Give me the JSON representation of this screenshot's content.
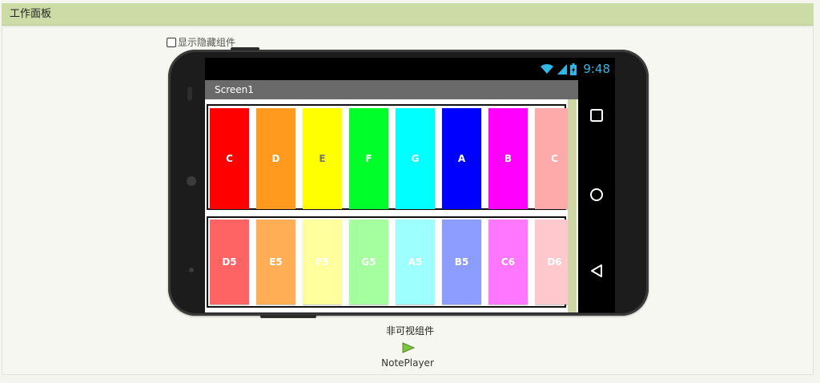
{
  "panel": {
    "title": "工作面板"
  },
  "toggle": {
    "label": "显示隐藏组件"
  },
  "status": {
    "time": "9:48"
  },
  "screen": {
    "title": "Screen1"
  },
  "keys_top": [
    {
      "label": "C",
      "color": "#ff0000",
      "text": "#ffffff"
    },
    {
      "label": "D",
      "color": "#ff9a1f",
      "text": "#ffffff"
    },
    {
      "label": "E",
      "color": "#ffff00",
      "text": "#777777"
    },
    {
      "label": "F",
      "color": "#00ff2a",
      "text": "#ffffff"
    },
    {
      "label": "G",
      "color": "#00ffff",
      "text": "#ffffff"
    },
    {
      "label": "A",
      "color": "#0000ff",
      "text": "#ffffff"
    },
    {
      "label": "B",
      "color": "#ff00ff",
      "text": "#ffffff"
    },
    {
      "label": "C",
      "color": "#ffaaaa",
      "text": "#ffffff"
    }
  ],
  "keys_bottom": [
    {
      "label": "D5",
      "color": "#ff6464",
      "text": "#ffffff"
    },
    {
      "label": "E5",
      "color": "#ffae55",
      "text": "#ffffff"
    },
    {
      "label": "F5",
      "color": "#ffff9e",
      "text": "#ffffff"
    },
    {
      "label": "G5",
      "color": "#a6ff9e",
      "text": "#ffffff"
    },
    {
      "label": "A5",
      "color": "#9effff",
      "text": "#ffffff"
    },
    {
      "label": "B5",
      "color": "#8c9cff",
      "text": "#ffffff"
    },
    {
      "label": "C6",
      "color": "#ff77ff",
      "text": "#ffffff"
    },
    {
      "label": "D6",
      "color": "#ffc8cc",
      "text": "#ffffff"
    }
  ],
  "nonvisible": {
    "title": "非可视组件",
    "component": "NotePlayer",
    "icon": "play-icon"
  },
  "colors": {
    "header": "#cddba6",
    "status_accent": "#33b5e5",
    "titlebar": "#6a6a6a",
    "scrollbar": "#cfd6a6"
  }
}
